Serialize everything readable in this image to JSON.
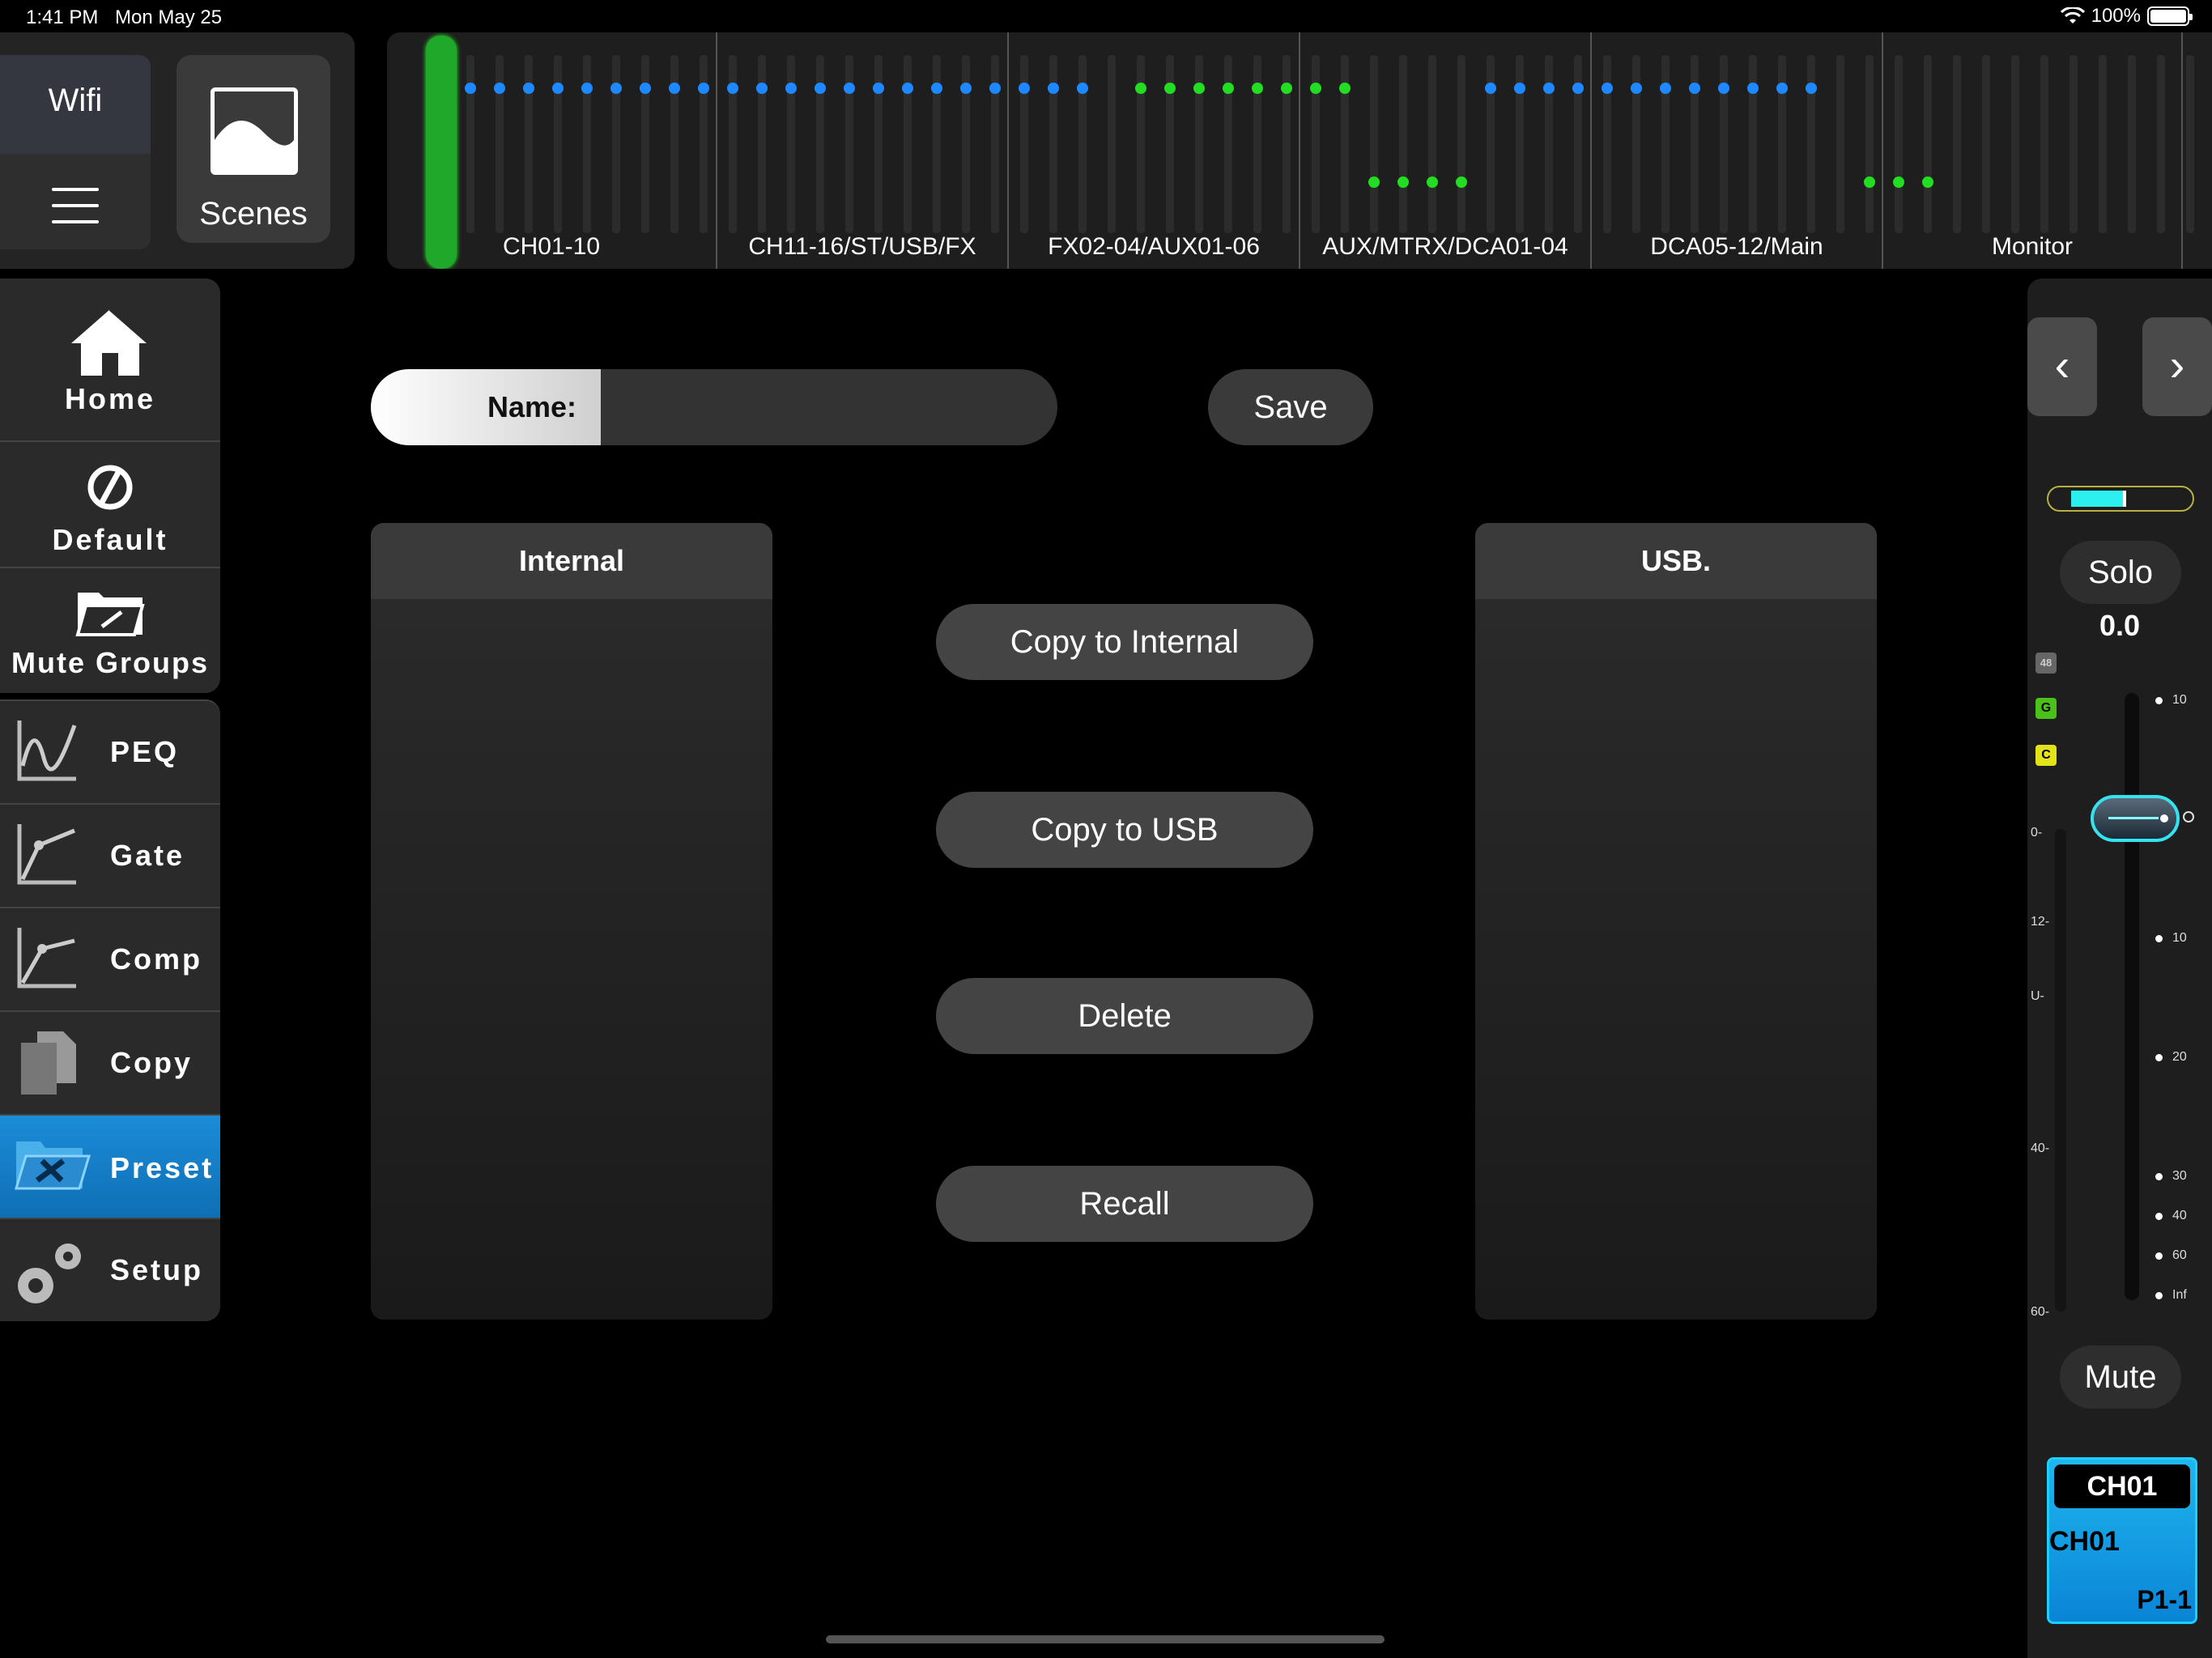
{
  "status_bar": {
    "time": "1:41 PM",
    "date": "Mon May 25",
    "battery": "100%"
  },
  "top_left": {
    "wifi_label": "Wifi",
    "scenes_label": "Scenes"
  },
  "overview": {
    "sections": [
      "CH01-10",
      "CH11-16/ST/USB/FX",
      "FX02-04/AUX01-06",
      "AUX/MTRX/DCA01-04",
      "DCA05-12/Main",
      "Monitor"
    ],
    "colors": {
      "blue": "#1e88ff",
      "green": "#22dd22",
      "selected": "#1fa82a"
    }
  },
  "nav": {
    "home": "Home",
    "default": "Default",
    "mute_groups": "Mute Groups",
    "peq": "PEQ",
    "gate": "Gate",
    "comp": "Comp",
    "copy": "Copy",
    "preset": "Preset",
    "setup": "Setup",
    "active": "Preset",
    "accent": "#1b8cd8"
  },
  "main": {
    "name_label": "Name:",
    "name_value": "",
    "save": "Save",
    "internal_header": "Internal",
    "usb_header": "USB.",
    "copy_to_internal": "Copy to Internal",
    "copy_to_usb": "Copy to USB",
    "delete": "Delete",
    "recall": "Recall"
  },
  "channel_strip": {
    "prev": "‹",
    "next": "›",
    "solo": "Solo",
    "gain": "0.0",
    "tag_48": "48",
    "tag_g": "G",
    "tag_c": "C",
    "meter_scale": [
      "0-",
      "12-",
      "U-",
      "40-",
      "60-"
    ],
    "fader_scale": [
      "10",
      "10",
      "20",
      "30",
      "40",
      "60",
      "Inf"
    ],
    "mute": "Mute",
    "card_title": "CH01",
    "card_name": "CH01",
    "card_port": "P1-1",
    "accent": "#35e2ee"
  }
}
